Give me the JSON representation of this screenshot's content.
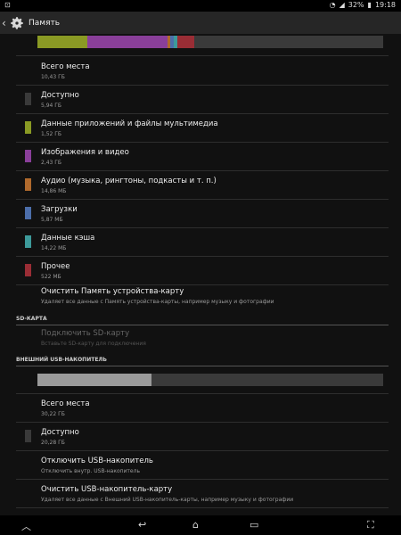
{
  "status": {
    "battery": "32%",
    "time": "19:18"
  },
  "header": {
    "title": "Память"
  },
  "device_storage": {
    "bar_segments": [
      {
        "name": "apps",
        "fraction": 0.145,
        "color": "#8a9a24"
      },
      {
        "name": "images",
        "fraction": 0.231,
        "color": "#8a3f9a"
      },
      {
        "name": "audio",
        "fraction": 0.008,
        "color": "#b06a2d"
      },
      {
        "name": "downloads",
        "fraction": 0.01,
        "color": "#4c6eaa"
      },
      {
        "name": "cache",
        "fraction": 0.01,
        "color": "#3d9a9a"
      },
      {
        "name": "other",
        "fraction": 0.05,
        "color": "#9a2d35"
      }
    ],
    "items": [
      {
        "label": "Всего места",
        "value": "10,43 ГБ",
        "color": ""
      },
      {
        "label": "Доступно",
        "value": "5,94 ГБ",
        "color": "#3a3a3a"
      },
      {
        "label": "Данные приложений и файлы мультимедиа",
        "value": "1,52 ГБ",
        "color": "#8a9a24"
      },
      {
        "label": "Изображения и видео",
        "value": "2,43 ГБ",
        "color": "#8a3f9a"
      },
      {
        "label": "Аудио (музыка, рингтоны, подкасты и т. п.)",
        "value": "14,86 МБ",
        "color": "#b06a2d"
      },
      {
        "label": "Загрузки",
        "value": "5,87 МБ",
        "color": "#4c6eaa"
      },
      {
        "label": "Данные кэша",
        "value": "14,22 МБ",
        "color": "#3d9a9a"
      },
      {
        "label": "Прочее",
        "value": "522 МБ",
        "color": "#9a2d35"
      }
    ],
    "clear": {
      "label": "Очистить Память устройства-карту",
      "sub": "Удаляет все данные с Память устройства-карты, например музыку и фотографии"
    }
  },
  "sd_card": {
    "section": "SD-КАРТА",
    "connect": {
      "label": "Подключить SD-карту",
      "sub": "Вставьте SD-карту для подключения"
    }
  },
  "usb": {
    "section": "ВНЕШНИЙ USB-НАКОПИТЕЛЬ",
    "bar_used_fraction": 0.33,
    "bar_used_color": "#9a9a9a",
    "total": {
      "label": "Всего места",
      "value": "30,22 ГБ"
    },
    "available": {
      "label": "Доступно",
      "value": "20,28 ГБ",
      "color": "#3a3a3a"
    },
    "unmount": {
      "label": "Отключить USB-накопитель",
      "sub": "Отключить внутр. USB-накопитель"
    },
    "clear": {
      "label": "Очистить USB-накопитель-карту",
      "sub": "Удаляет все данные с Внешний USB-накопитель-карты, например музыку и фотографии"
    }
  }
}
